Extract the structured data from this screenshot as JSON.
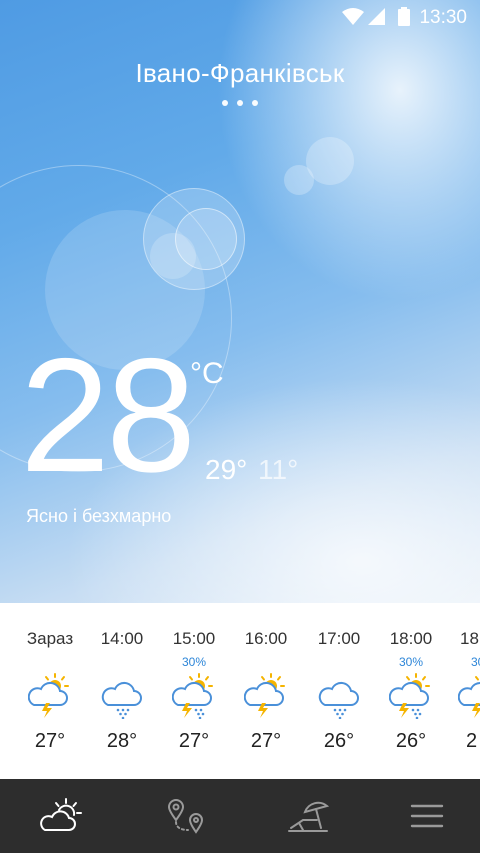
{
  "status_bar": {
    "time": "13:30",
    "icons": [
      "wifi-icon",
      "cell-signal-icon",
      "battery-icon"
    ]
  },
  "location": {
    "city": "Івано-Франківськ",
    "page_count": 3
  },
  "current": {
    "temperature": "28",
    "unit": "°C",
    "high": "29°",
    "low": "11°",
    "condition": "Ясно і безхмарно"
  },
  "hourly": [
    {
      "time": "Зараз",
      "precip": "",
      "icon": "thunderstorm-partly-sunny-icon",
      "temp": "27°"
    },
    {
      "time": "14:00",
      "precip": "",
      "icon": "snow-cloud-icon",
      "temp": "28°"
    },
    {
      "time": "15:00",
      "precip": "30%",
      "icon": "thunder-snow-partly-sunny-icon",
      "temp": "27°"
    },
    {
      "time": "16:00",
      "precip": "",
      "icon": "thunderstorm-partly-sunny-icon",
      "temp": "27°"
    },
    {
      "time": "17:00",
      "precip": "",
      "icon": "snow-cloud-icon",
      "temp": "26°"
    },
    {
      "time": "18:00",
      "precip": "30%",
      "icon": "thunder-snow-partly-sunny-icon",
      "temp": "26°"
    },
    {
      "time": "18",
      "precip": "30",
      "icon": "thunderstorm-partly-sunny-icon",
      "temp": "2"
    }
  ],
  "navbar": {
    "items": [
      "weather-icon",
      "locations-map-icon",
      "beach-umbrella-icon",
      "menu-icon"
    ]
  },
  "colors": {
    "nav_bg": "#2d2d2d",
    "accent": "#2d86d8",
    "sun": "#f5b400",
    "cloud_stroke": "#4a90d9"
  }
}
